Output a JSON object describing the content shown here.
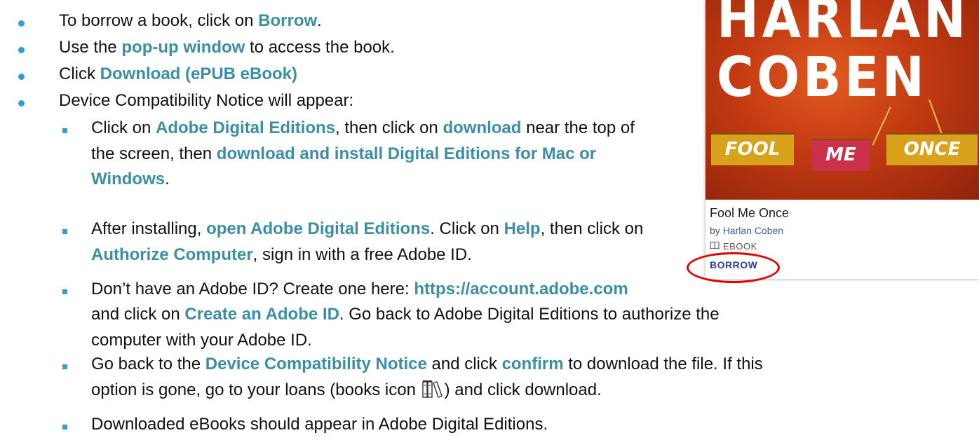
{
  "instructions": {
    "b1": {
      "pre": "To borrow a book, click on ",
      "hl": "Borrow",
      "post": "."
    },
    "b2": {
      "pre": "Use the ",
      "hl": "pop-up window",
      "post": " to access the book."
    },
    "b3": {
      "pre": "Click ",
      "hl": "Download (ePUB eBook)"
    },
    "b4": {
      "text": "Device Compatibility Notice will appear:"
    },
    "s1": {
      "p1": "Click on ",
      "h1": "Adobe Digital Editions",
      "p2": ", then click on ",
      "h2": "download",
      "p3": " near the top of",
      "p4": "the screen, then ",
      "h3": "download and install Digital Editions for Mac or",
      "h4": "Windows",
      "p5": "."
    },
    "s2": {
      "p1": "After installing, ",
      "h1": "open Adobe Digital Editions",
      "p2": ". Click on ",
      "h2": "Help",
      "p3": ", then click on",
      "h3": "Authorize Computer",
      "p4": ", sign in with a free Adobe ID."
    },
    "s3": {
      "p1": "Don’t have an Adobe ID? Create one here: ",
      "h1": "https://account.adobe.com",
      "p2": "and click on ",
      "h2": "Create an Adobe ID",
      "p3": ". Go back to Adobe Digital Editions to authorize the",
      "p4": "computer with your Adobe ID."
    },
    "s4": {
      "p1": "Go back to the ",
      "h1": "Device Compatibility Notice",
      "p2": " and click ",
      "h2": "confirm",
      "p3": " to download the file. If this",
      "p4": "option is gone, go to your loans (books icon ",
      "p5": ") and click download."
    },
    "s5": {
      "text": "Downloaded eBooks should appear in Adobe Digital Editions."
    }
  },
  "book": {
    "cover_line1": "HARLAN",
    "cover_line2": "COBEN",
    "plate1": "FOOL",
    "plate2": "ME",
    "plate3": "ONCE",
    "title": "Fool Me Once",
    "by": "by",
    "author": "Harlan Coben",
    "format": "EBOOK",
    "borrow_label": "BORROW"
  },
  "colors": {
    "highlight": "#3a8fa6",
    "bullet": "#2f9fd0",
    "circle": "#e00000",
    "borrow": "#2b3e9b"
  }
}
